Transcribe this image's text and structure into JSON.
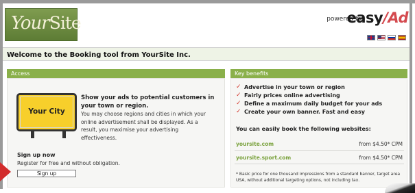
{
  "header": {
    "logo_script": "Your",
    "logo_site": "Site",
    "powered_by": "powered by",
    "brand_easy": "easy",
    "brand_ad": "Ad",
    "language_flags": [
      "uk-flag-icon",
      "us-flag-icon",
      "ru-flag-icon",
      "es-flag-icon"
    ]
  },
  "welcome": "Welcome to the Booking tool from YourSite Inc.",
  "access": {
    "heading": "Access",
    "sign_text": "Your City",
    "title": "Show your ads to potential customers in your town or region.",
    "description": "You may choose regions and cities in which your online advertisement shall be displayed. As a result, you maximise your advertising effectiveness.",
    "signup_title": "Sign up now",
    "signup_description": "Register for free and without obligation.",
    "signup_button": "Sign up"
  },
  "benefits": {
    "heading": "Key benefits",
    "items": [
      "Advertise in your town or region",
      "Fairly prices online advertising",
      "Define a maximum daily budget for your ads",
      "Create your own banner. Fast and easy"
    ],
    "book_title": "You can easily book the following websites:",
    "websites": [
      {
        "name": "yoursite.com",
        "price": "from $4.50* CPM"
      },
      {
        "name": "yoursite.sport.com",
        "price": "from $4.50* CPM"
      }
    ],
    "footnote": "* Basic price for one thousand impressions from a standard banner, target area USA, without additional targeting options, not including tax."
  },
  "colors": {
    "accent_green": "#8ab04a",
    "link_green": "#7aa23d",
    "brand_red": "#d44a4f",
    "sign_yellow": "#f7cf2b"
  }
}
